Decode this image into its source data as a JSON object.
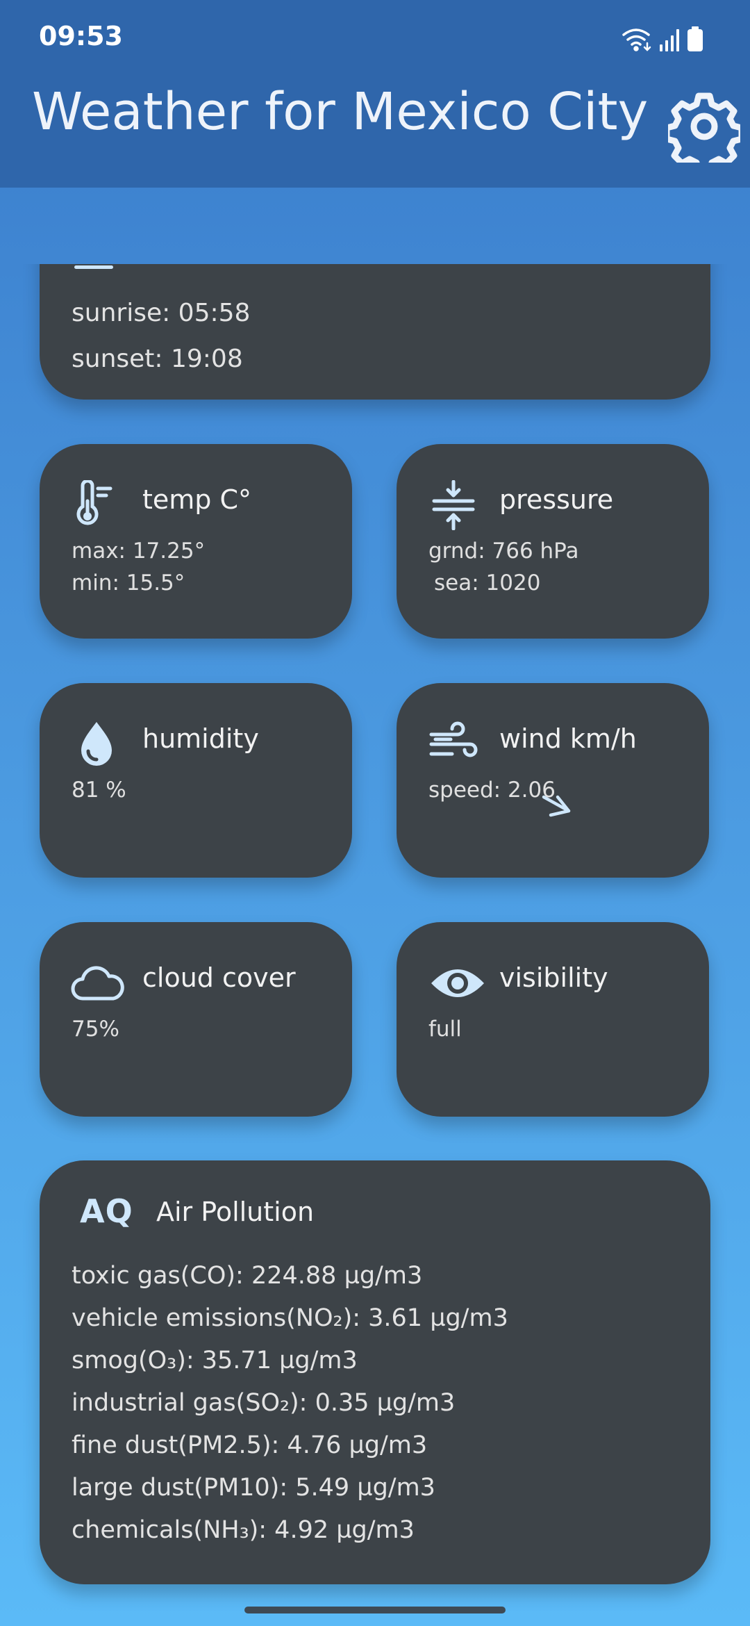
{
  "status_bar": {
    "time": "09:53",
    "icons": [
      "wifi-icon",
      "signal-icon",
      "battery-icon"
    ]
  },
  "app_bar": {
    "title": "Weather for Mexico City",
    "settings_icon": "gear-icon"
  },
  "sun_card": {
    "sunrise": "sunrise: 05:58",
    "sunset": "sunset: 19:08"
  },
  "temp_card": {
    "title": "temp C°",
    "max": "max: 17.25°",
    "min": "min: 15.5°"
  },
  "pressure_card": {
    "title": "pressure",
    "grnd": "grnd: 766 hPa",
    "sea": "sea: 1020"
  },
  "humidity_card": {
    "title": "humidity",
    "value": "81 %"
  },
  "wind_card": {
    "title": "wind km/h",
    "speed": "speed: 2.06"
  },
  "cloud_card": {
    "title": "cloud cover",
    "value": "75%"
  },
  "visibility_card": {
    "title": "visibility",
    "value": "full"
  },
  "air_card": {
    "icon_text": "AQ",
    "title": "Air Pollution",
    "co": "toxic gas(CO): 224.88 µg/m3",
    "no2": "vehicle emissions(NO₂): 3.61 µg/m3",
    "o3": "smog(O₃): 35.71 µg/m3",
    "so2": "industrial gas(SO₂): 0.35 µg/m3",
    "pm25": "fine dust(PM2.5): 4.76 µg/m3",
    "pm10": "large dust(PM10): 5.49 µg/m3",
    "nh3": "chemicals(NH₃): 4.92 µg/m3"
  },
  "colors": {
    "app_bar": "#2f66ab",
    "card_bg": "#3d4348",
    "icon_accent": "#cfe7fb"
  }
}
